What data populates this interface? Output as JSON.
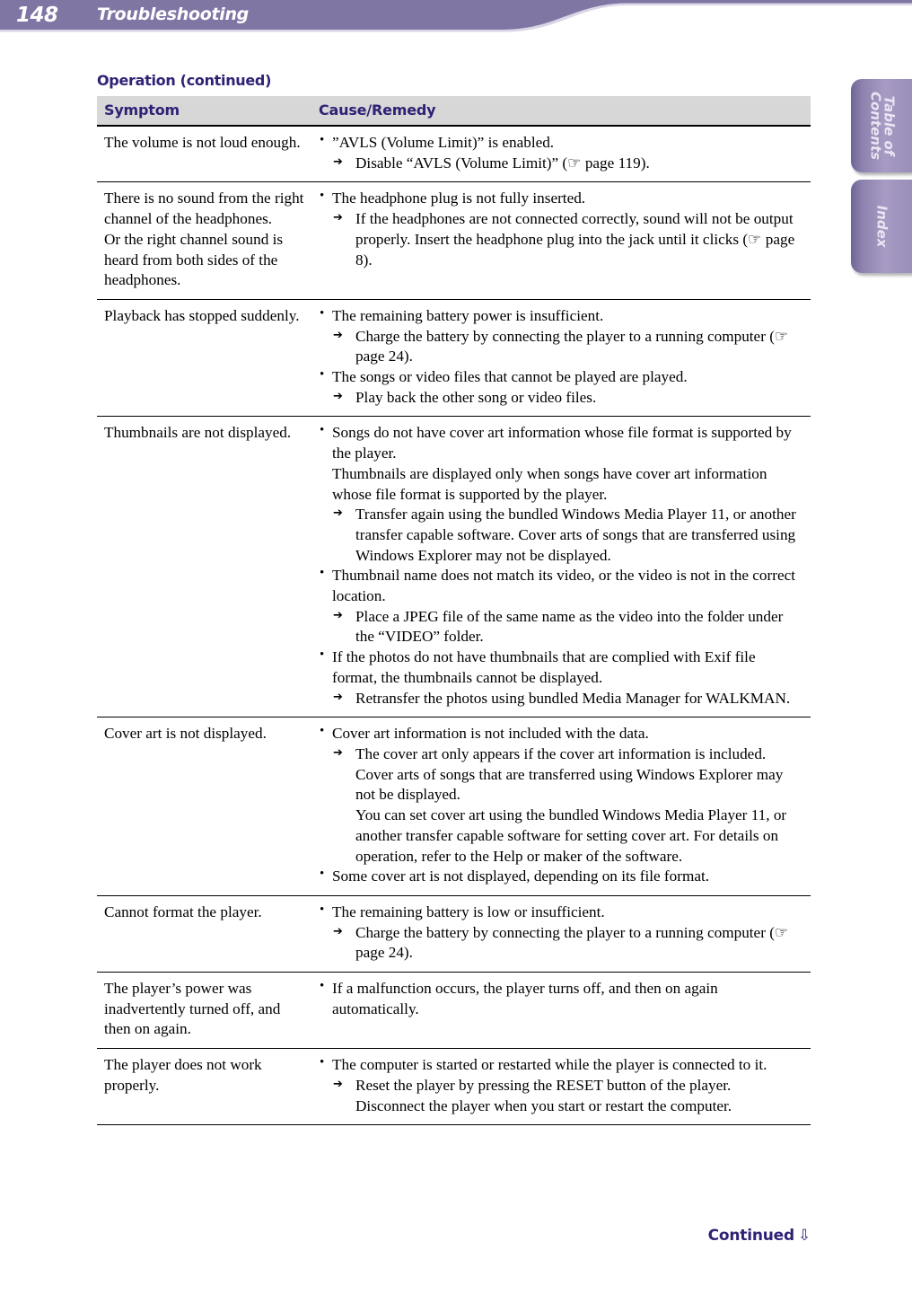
{
  "header": {
    "page_number": "148",
    "title": "Troubleshooting",
    "band_color": "#8076a4"
  },
  "side_tabs": [
    {
      "name": "table-of-contents",
      "label": "Table of\nContents",
      "line1": "Table of",
      "line2": "Contents"
    },
    {
      "name": "index",
      "label": "Index",
      "line1": "Index",
      "line2": ""
    }
  ],
  "section": {
    "heading": "Operation (continued)",
    "heading_color": "#2f2175"
  },
  "table": {
    "columns": [
      "Symptom",
      "Cause/Remedy"
    ],
    "header_bg": "#d7d7d7",
    "rows": [
      {
        "symptom": "The volume is not loud enough.",
        "causes": [
          {
            "cause": "”AVLS (Volume Limit)” is enabled.",
            "remedies": [
              "Disable “AVLS (Volume Limit)” (☞ page 119)."
            ]
          }
        ]
      },
      {
        "symptom": "There is no sound from the right channel of the headphones.\nOr the right channel sound is heard from both sides of the headphones.",
        "symptom_lines": [
          "There is no sound from the right channel of the headphones.",
          "Or the right channel sound is heard from both sides of the headphones."
        ],
        "causes": [
          {
            "cause": "The headphone plug is not fully inserted.",
            "remedies": [
              "If the headphones are not connected correctly, sound will not be output properly. Insert the headphone plug into the jack until it clicks (☞ page 8)."
            ]
          }
        ]
      },
      {
        "symptom": "Playback has stopped suddenly.",
        "causes": [
          {
            "cause": "The remaining battery power is insufficient.",
            "remedies": [
              "Charge the battery by connecting the player to a running computer (☞ page 24)."
            ]
          },
          {
            "cause": "The songs or video files that cannot be played are played.",
            "remedies": [
              "Play back the other song or video files."
            ]
          }
        ]
      },
      {
        "symptom": "Thumbnails are not displayed.",
        "causes": [
          {
            "cause": "Songs do not have cover art information whose file format is supported by the player.",
            "cause_extra": "Thumbnails are displayed only when songs have cover art information whose file format is supported by the player.",
            "remedies": [
              "Transfer again using the bundled Windows Media Player 11, or another transfer capable software. Cover arts of songs that are transferred using Windows Explorer may not be displayed."
            ]
          },
          {
            "cause": "Thumbnail name does not match its video, or the video is not in the correct location.",
            "remedies": [
              "Place a JPEG file of the same name as the video into the folder under the “VIDEO” folder."
            ]
          },
          {
            "cause": "If the photos do not have thumbnails that are complied with Exif file format, the thumbnails cannot be displayed.",
            "remedies": [
              "Retransfer the photos using bundled Media Manager for WALKMAN."
            ]
          }
        ]
      },
      {
        "symptom": "Cover art is not displayed.",
        "causes": [
          {
            "cause": "Cover art information is not included with the data.",
            "remedies": [
              "The cover art only appears if the cover art information is included. Cover arts of songs that are transferred using Windows Explorer may not be displayed."
            ],
            "remedy_extra": "You can set cover art using the bundled Windows Media Player 11, or another transfer capable software for setting cover art. For details on operation, refer to the Help or maker of the software."
          },
          {
            "cause": "Some cover art is not displayed, depending on its file format.",
            "remedies": []
          }
        ]
      },
      {
        "symptom": "Cannot format the player.",
        "causes": [
          {
            "cause": "The remaining battery is low or insufficient.",
            "remedies": [
              "Charge the battery by connecting the player to a running computer (☞ page 24)."
            ]
          }
        ]
      },
      {
        "symptom": "The player’s power was inadvertently turned off, and then on again.",
        "causes": [
          {
            "cause": "If a malfunction occurs, the player turns off, and then on again automatically.",
            "remedies": []
          }
        ]
      },
      {
        "symptom": "The player does not work properly.",
        "causes": [
          {
            "cause": "The computer is started or restarted while the player is connected to it.",
            "remedies": [
              "Reset the player by pressing the RESET button of the player. Disconnect the player when you start or restart the computer."
            ]
          }
        ]
      }
    ]
  },
  "footer": {
    "continued_label": "Continued",
    "arrow": "⇩",
    "color": "#2f2175"
  }
}
